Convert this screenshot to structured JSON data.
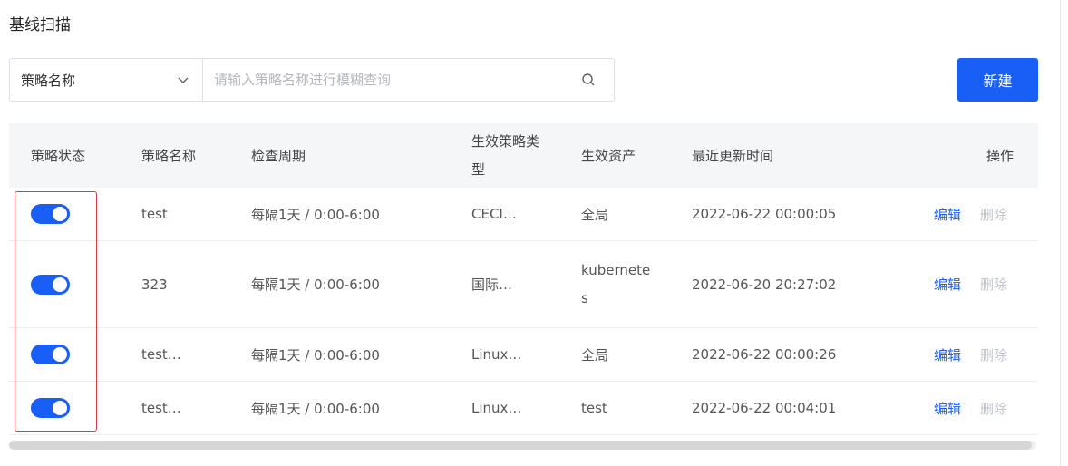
{
  "page": {
    "title": "基线扫描"
  },
  "toolbar": {
    "filter_select_value": "策略名称",
    "search_placeholder": "请输入策略名称进行模糊查询",
    "new_button_label": "新建"
  },
  "table": {
    "columns": [
      "策略状态",
      "策略名称",
      "检查周期",
      "生效策略类型",
      "生效资产",
      "最近更新时间",
      "操作"
    ],
    "rows": [
      {
        "enabled": true,
        "name": "test",
        "period": "每隔1天 / 0:00-6:00",
        "type": "CECI…",
        "asset": "全局",
        "updated": "2022-06-22 00:00:05",
        "edit": "编辑",
        "delete": "删除"
      },
      {
        "enabled": true,
        "name": "323",
        "period": "每隔1天 / 0:00-6:00",
        "type": "国际…",
        "asset": "kubernetes",
        "updated": "2022-06-20 20:27:02",
        "edit": "编辑",
        "delete": "删除"
      },
      {
        "enabled": true,
        "name": "test…",
        "period": "每隔1天 / 0:00-6:00",
        "type": "Linux…",
        "asset": "全局",
        "updated": "2022-06-22 00:00:26",
        "edit": "编辑",
        "delete": "删除"
      },
      {
        "enabled": true,
        "name": "test…",
        "period": "每隔1天 / 0:00-6:00",
        "type": "Linux…",
        "asset": "test",
        "updated": "2022-06-22 00:04:01",
        "edit": "编辑",
        "delete": "删除"
      }
    ]
  },
  "colors": {
    "primary": "#1a5ff5",
    "highlight": "#e0393e",
    "disabled": "#c0c4cc"
  },
  "icons": {
    "select_arrow": "chevron-down-icon",
    "search": "search-icon"
  }
}
